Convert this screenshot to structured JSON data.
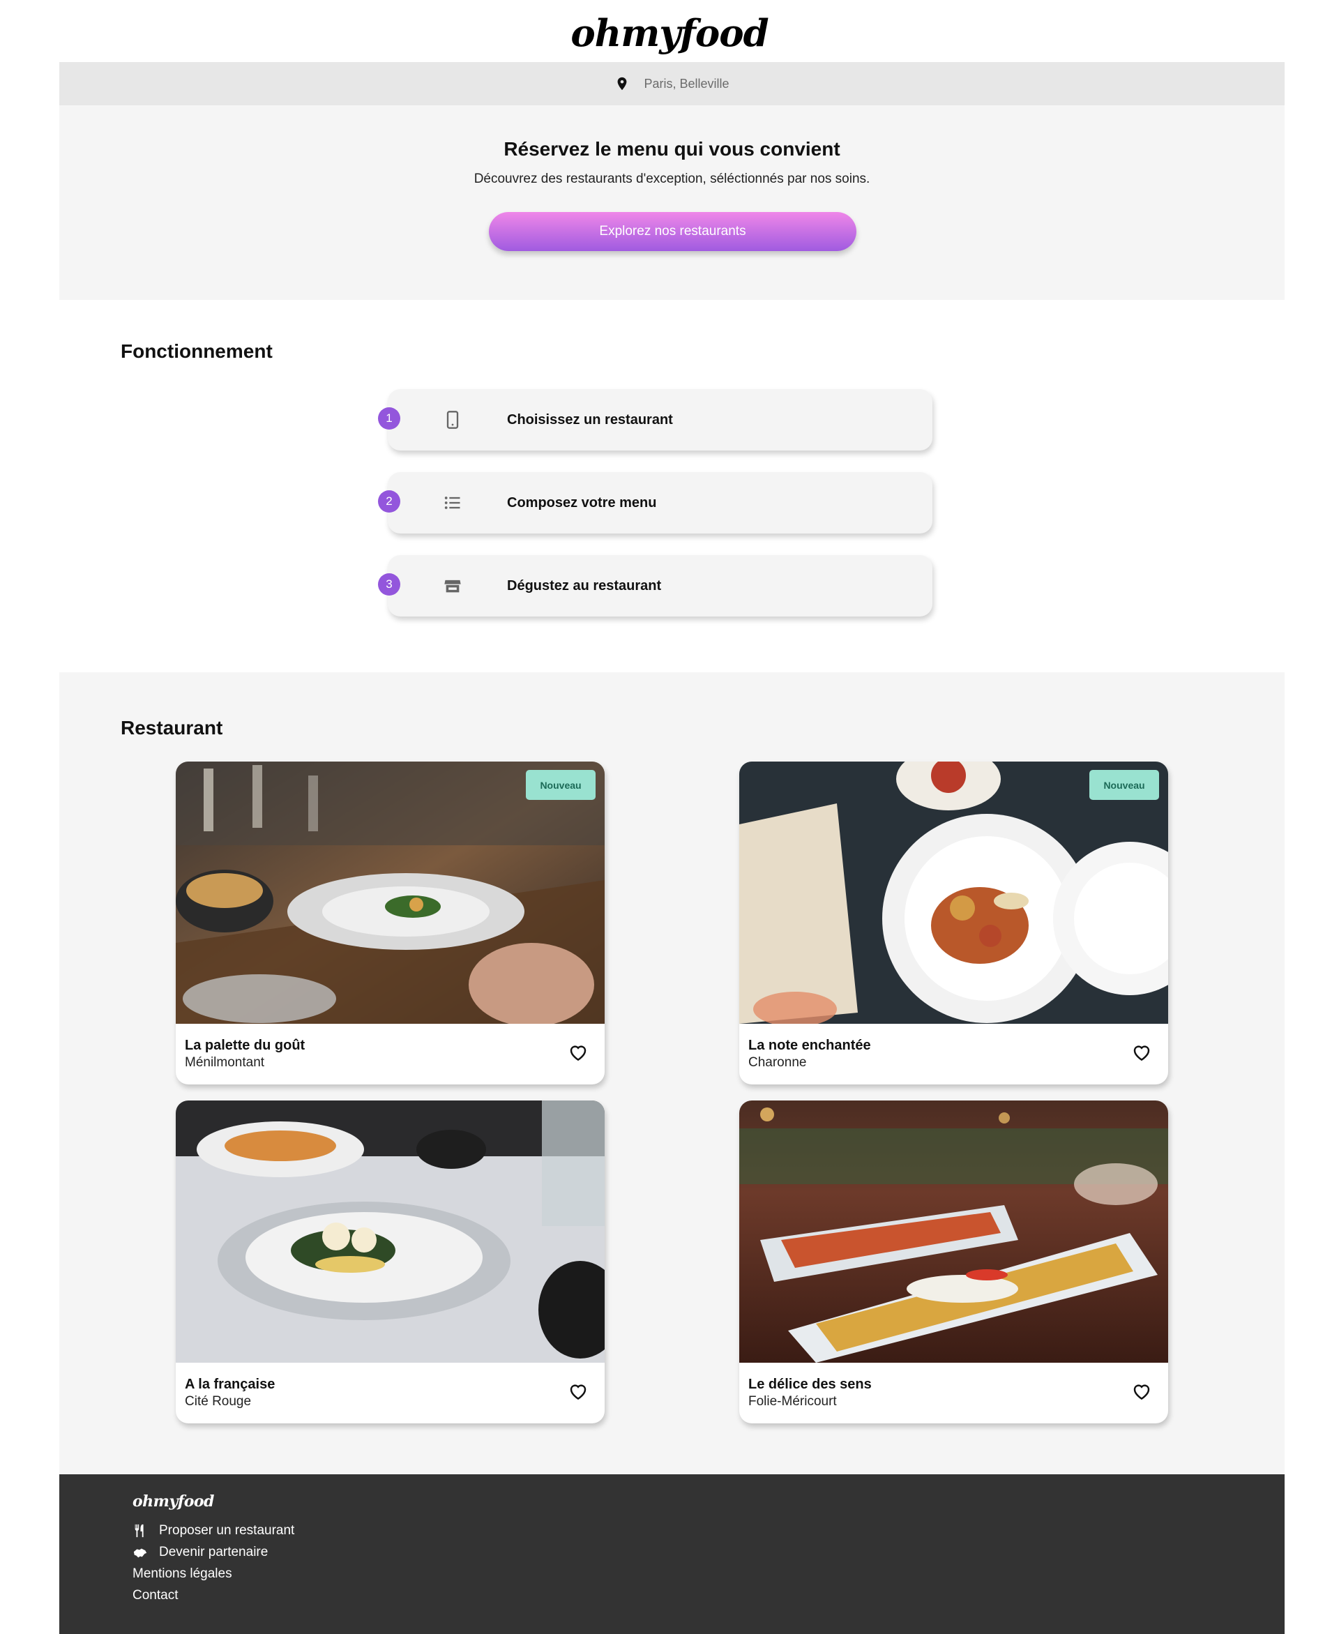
{
  "header": {
    "logo": "ohmyfood",
    "location": "Paris, Belleville",
    "location_icon": "map-pin-icon"
  },
  "hero": {
    "title": "Réservez le menu qui vous convient",
    "subtitle": "Découvrez des restaurants d'exception, séléctionnés par nos soins.",
    "cta_label": "Explorez nos restaurants"
  },
  "how_it_works": {
    "title": "Fonctionnement",
    "steps": [
      {
        "number": "1",
        "label": "Choisissez un restaurant",
        "icon": "mobile-phone-icon"
      },
      {
        "number": "2",
        "label": "Composez votre menu",
        "icon": "list-icon"
      },
      {
        "number": "3",
        "label": "Dégustez au restaurant",
        "icon": "store-icon"
      }
    ]
  },
  "restaurants": {
    "title": "Restaurant",
    "items": [
      {
        "name": "La palette du goût",
        "area": "Ménilmontant",
        "badge": "Nouveau"
      },
      {
        "name": "La note enchantée",
        "area": "Charonne",
        "badge": "Nouveau"
      },
      {
        "name": "A la française",
        "area": "Cité Rouge",
        "badge": ""
      },
      {
        "name": "Le délice des sens",
        "area": "Folie-Méricourt",
        "badge": ""
      }
    ]
  },
  "footer": {
    "logo": "ohmyfood",
    "links": [
      {
        "label": "Proposer un restaurant",
        "icon": "utensils-icon"
      },
      {
        "label": "Devenir partenaire",
        "icon": "handshake-icon"
      },
      {
        "label": "Mentions légales",
        "icon": ""
      },
      {
        "label": "Contact",
        "icon": ""
      }
    ]
  },
  "colors": {
    "accent_purple": "#9356dc",
    "button_gradient_top": "#ef87e8",
    "button_gradient_bottom": "#a05be0",
    "badge_bg": "#99e2d0",
    "footer_bg": "#333333"
  }
}
